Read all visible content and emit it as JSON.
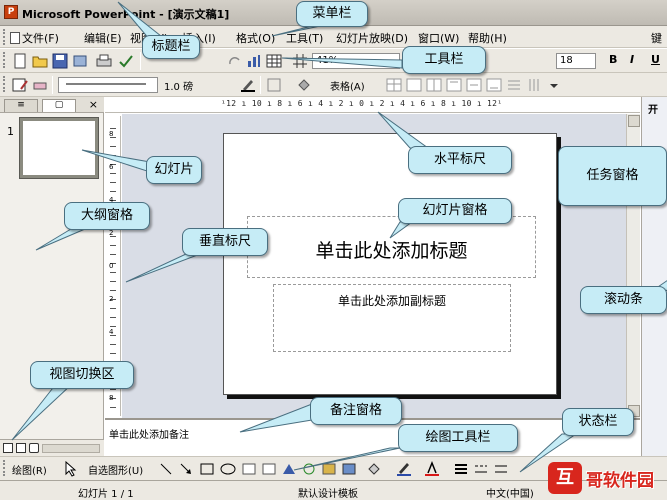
{
  "window": {
    "title": "Microsoft PowerPoint - [演示文稿1]",
    "app_icon": "P"
  },
  "menu": {
    "items": [
      {
        "label": "文件(F)"
      },
      {
        "label": "编辑(E)"
      },
      {
        "label": "视图(V)"
      },
      {
        "label": "插入(I)"
      },
      {
        "label": "格式(O)"
      },
      {
        "label": "工具(T)"
      },
      {
        "label": "幻灯片放映(D)"
      },
      {
        "label": "窗口(W)"
      },
      {
        "label": "帮助(H)"
      }
    ],
    "help_box": "键"
  },
  "toolbar": {
    "zoom": "41%",
    "font_size": "18",
    "bold": "B",
    "italic": "I",
    "underline": "U",
    "line_weight": "1.0 磅",
    "table_label": "表格(A)"
  },
  "left_pane": {
    "slide_number": "1",
    "close": "×"
  },
  "slide": {
    "title_placeholder": "单击此处添加标题",
    "subtitle_placeholder": "单击此处添加副标题"
  },
  "ruler": {
    "horizontal": "¹12 ı 10 ı 8 ı 6 ı 4 ı 2 ı 0 ı 2 ı 4 ı 6 ı 8 ı 10 ı 12¹",
    "vertical_labels": [
      "8",
      "6",
      "4",
      "2",
      "0",
      "2",
      "4",
      "6",
      "8"
    ]
  },
  "notes": {
    "placeholder": "单击此处添加备注"
  },
  "task_pane": {
    "heading": "开"
  },
  "draw_toolbar": {
    "draw_label": "绘图(R)",
    "autoshape_label": "自选图形(U)"
  },
  "status_bar": {
    "slide_position": "幻灯片 1 / 1",
    "design_template": "默认设计模板",
    "language": "中文(中国)"
  },
  "callouts": {
    "title_bar": "标题栏",
    "menu_bar": "菜单栏",
    "toolbar": "工具栏",
    "h_ruler": "水平标尺",
    "task_pane": "任务窗格",
    "slide_thumb": "幻灯片",
    "outline_pane": "大纲窗格",
    "v_ruler": "垂直标尺",
    "slide_pane": "幻灯片窗格",
    "scrollbar": "滚动条",
    "view_switch": "视图切换区",
    "notes_pane": "备注窗格",
    "status_bar": "状态栏",
    "draw_toolbar": "绘图工具栏"
  },
  "watermark": {
    "badge": "互",
    "text": "哥软件园"
  }
}
